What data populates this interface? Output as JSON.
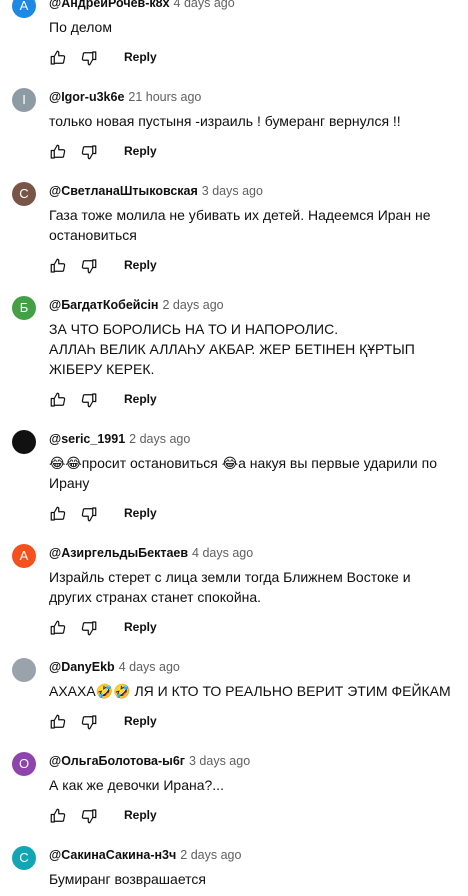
{
  "icons": {
    "like": "thumb-up-icon",
    "dislike": "thumb-down-icon"
  },
  "reply_label": "Reply",
  "comments": [
    {
      "author": "@АндрейРочев-к8х",
      "time": "4 days ago",
      "text": "По делом",
      "avatar_letter": "А",
      "avatar_color": "#1e88e5"
    },
    {
      "author": "@Igor-u3k6e",
      "time": "21 hours ago",
      "text": "только новая пустыня -израиль ! бумеранг вернулся !!",
      "avatar_letter": "I",
      "avatar_color": "#8d9ba4"
    },
    {
      "author": "@СветланаШтыковская",
      "time": "3 days ago",
      "text": "Газа тоже молила не убивать их детей. Надеемся Иран не\nостановиться",
      "avatar_letter": "С",
      "avatar_color": "#795548"
    },
    {
      "author": "@БагдатКобейсін",
      "time": "2 days ago",
      "text": "ЗА ЧТО БОРОЛИСЬ НА ТО И НАПОРОЛИС.\nАЛЛАҺ ВЕЛИК АЛЛАҺУ АКБАР.  ЖЕР БЕТІНЕН ҚҰРТЫП\nЖІБЕРУ КЕРЕК.",
      "avatar_letter": "Б",
      "avatar_color": "#43a047"
    },
    {
      "author": "@seric_1991",
      "time": "2 days ago",
      "text": "😂😂просит остановиться 😂а накуя вы первые ударили по\nИрану",
      "avatar_letter": "",
      "avatar_color": "#111111"
    },
    {
      "author": "@АзиргельдыБектаев",
      "time": "4 days ago",
      "text": "Израйль стерет с лица земли тогда Ближнем Востоке и\nдругих странах станет спокойна.",
      "avatar_letter": "А",
      "avatar_color": "#f4511e"
    },
    {
      "author": "@DanyEkb",
      "time": "4 days ago",
      "text": "АХАХА🤣🤣 ЛЯ И КТО ТО РЕАЛЬНО ВЕРИТ ЭТИМ ФЕЙКАМ",
      "avatar_letter": "",
      "avatar_color": "#9aa3ab"
    },
    {
      "author": "@ОльгаБолотова-ы6г",
      "time": "3 days ago",
      "text": "А как же девочки Ирана?...",
      "avatar_letter": "О",
      "avatar_color": "#8e44ad"
    },
    {
      "author": "@СакинаСакина-н3ч",
      "time": "2 days ago",
      "text": "Бумиранг возврашается",
      "avatar_letter": "С",
      "avatar_color": "#12a5b4"
    }
  ]
}
